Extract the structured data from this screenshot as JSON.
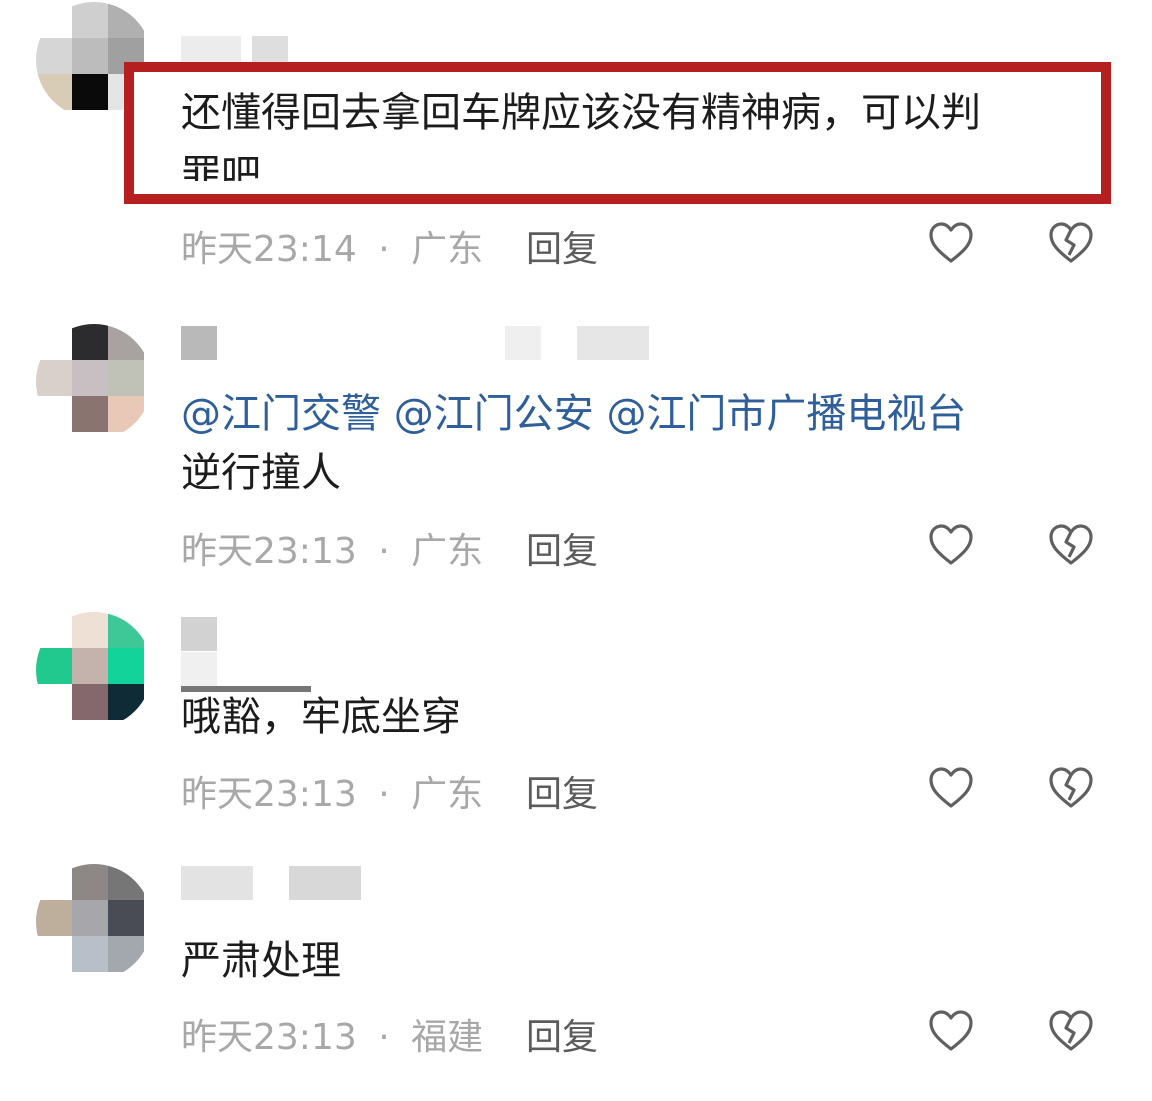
{
  "comments": [
    {
      "text_line1": "还懂得回去拿回车牌应该没有精神病，可以判",
      "text_line2": "罪吧",
      "time": "昨天23:14",
      "separator": "·",
      "location": "广东",
      "reply_label": "回复",
      "highlighted": true
    },
    {
      "mentions": [
        "@江门交警",
        "@江门公安",
        "@江门市广播电视台"
      ],
      "text": "逆行撞人",
      "time": "昨天23:13",
      "separator": "·",
      "location": "广东",
      "reply_label": "回复"
    },
    {
      "text": "哦豁，牢底坐穿",
      "time": "昨天23:13",
      "separator": "·",
      "location": "广东",
      "reply_label": "回复"
    },
    {
      "text": "严肃处理",
      "time": "昨天23:13",
      "separator": "·",
      "location": "福建",
      "reply_label": "回复"
    }
  ],
  "colors": {
    "highlight_border": "#b51f1f",
    "mention": "#2f5f9a",
    "meta": "#a8a8a8",
    "reply": "#5c5c5c"
  },
  "icons": [
    "like-heart-icon",
    "dislike-broken-heart-icon"
  ]
}
